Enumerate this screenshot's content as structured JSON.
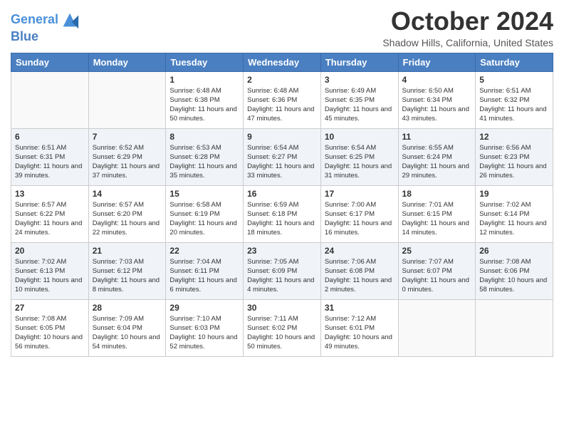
{
  "header": {
    "logo_line1": "General",
    "logo_line2": "Blue",
    "month_title": "October 2024",
    "location": "Shadow Hills, California, United States"
  },
  "days_of_week": [
    "Sunday",
    "Monday",
    "Tuesday",
    "Wednesday",
    "Thursday",
    "Friday",
    "Saturday"
  ],
  "weeks": [
    [
      {
        "day": "",
        "info": ""
      },
      {
        "day": "",
        "info": ""
      },
      {
        "day": "1",
        "info": "Sunrise: 6:48 AM\nSunset: 6:38 PM\nDaylight: 11 hours and 50 minutes."
      },
      {
        "day": "2",
        "info": "Sunrise: 6:48 AM\nSunset: 6:36 PM\nDaylight: 11 hours and 47 minutes."
      },
      {
        "day": "3",
        "info": "Sunrise: 6:49 AM\nSunset: 6:35 PM\nDaylight: 11 hours and 45 minutes."
      },
      {
        "day": "4",
        "info": "Sunrise: 6:50 AM\nSunset: 6:34 PM\nDaylight: 11 hours and 43 minutes."
      },
      {
        "day": "5",
        "info": "Sunrise: 6:51 AM\nSunset: 6:32 PM\nDaylight: 11 hours and 41 minutes."
      }
    ],
    [
      {
        "day": "6",
        "info": "Sunrise: 6:51 AM\nSunset: 6:31 PM\nDaylight: 11 hours and 39 minutes."
      },
      {
        "day": "7",
        "info": "Sunrise: 6:52 AM\nSunset: 6:29 PM\nDaylight: 11 hours and 37 minutes."
      },
      {
        "day": "8",
        "info": "Sunrise: 6:53 AM\nSunset: 6:28 PM\nDaylight: 11 hours and 35 minutes."
      },
      {
        "day": "9",
        "info": "Sunrise: 6:54 AM\nSunset: 6:27 PM\nDaylight: 11 hours and 33 minutes."
      },
      {
        "day": "10",
        "info": "Sunrise: 6:54 AM\nSunset: 6:25 PM\nDaylight: 11 hours and 31 minutes."
      },
      {
        "day": "11",
        "info": "Sunrise: 6:55 AM\nSunset: 6:24 PM\nDaylight: 11 hours and 29 minutes."
      },
      {
        "day": "12",
        "info": "Sunrise: 6:56 AM\nSunset: 6:23 PM\nDaylight: 11 hours and 26 minutes."
      }
    ],
    [
      {
        "day": "13",
        "info": "Sunrise: 6:57 AM\nSunset: 6:22 PM\nDaylight: 11 hours and 24 minutes."
      },
      {
        "day": "14",
        "info": "Sunrise: 6:57 AM\nSunset: 6:20 PM\nDaylight: 11 hours and 22 minutes."
      },
      {
        "day": "15",
        "info": "Sunrise: 6:58 AM\nSunset: 6:19 PM\nDaylight: 11 hours and 20 minutes."
      },
      {
        "day": "16",
        "info": "Sunrise: 6:59 AM\nSunset: 6:18 PM\nDaylight: 11 hours and 18 minutes."
      },
      {
        "day": "17",
        "info": "Sunrise: 7:00 AM\nSunset: 6:17 PM\nDaylight: 11 hours and 16 minutes."
      },
      {
        "day": "18",
        "info": "Sunrise: 7:01 AM\nSunset: 6:15 PM\nDaylight: 11 hours and 14 minutes."
      },
      {
        "day": "19",
        "info": "Sunrise: 7:02 AM\nSunset: 6:14 PM\nDaylight: 11 hours and 12 minutes."
      }
    ],
    [
      {
        "day": "20",
        "info": "Sunrise: 7:02 AM\nSunset: 6:13 PM\nDaylight: 11 hours and 10 minutes."
      },
      {
        "day": "21",
        "info": "Sunrise: 7:03 AM\nSunset: 6:12 PM\nDaylight: 11 hours and 8 minutes."
      },
      {
        "day": "22",
        "info": "Sunrise: 7:04 AM\nSunset: 6:11 PM\nDaylight: 11 hours and 6 minutes."
      },
      {
        "day": "23",
        "info": "Sunrise: 7:05 AM\nSunset: 6:09 PM\nDaylight: 11 hours and 4 minutes."
      },
      {
        "day": "24",
        "info": "Sunrise: 7:06 AM\nSunset: 6:08 PM\nDaylight: 11 hours and 2 minutes."
      },
      {
        "day": "25",
        "info": "Sunrise: 7:07 AM\nSunset: 6:07 PM\nDaylight: 11 hours and 0 minutes."
      },
      {
        "day": "26",
        "info": "Sunrise: 7:08 AM\nSunset: 6:06 PM\nDaylight: 10 hours and 58 minutes."
      }
    ],
    [
      {
        "day": "27",
        "info": "Sunrise: 7:08 AM\nSunset: 6:05 PM\nDaylight: 10 hours and 56 minutes."
      },
      {
        "day": "28",
        "info": "Sunrise: 7:09 AM\nSunset: 6:04 PM\nDaylight: 10 hours and 54 minutes."
      },
      {
        "day": "29",
        "info": "Sunrise: 7:10 AM\nSunset: 6:03 PM\nDaylight: 10 hours and 52 minutes."
      },
      {
        "day": "30",
        "info": "Sunrise: 7:11 AM\nSunset: 6:02 PM\nDaylight: 10 hours and 50 minutes."
      },
      {
        "day": "31",
        "info": "Sunrise: 7:12 AM\nSunset: 6:01 PM\nDaylight: 10 hours and 49 minutes."
      },
      {
        "day": "",
        "info": ""
      },
      {
        "day": "",
        "info": ""
      }
    ]
  ]
}
